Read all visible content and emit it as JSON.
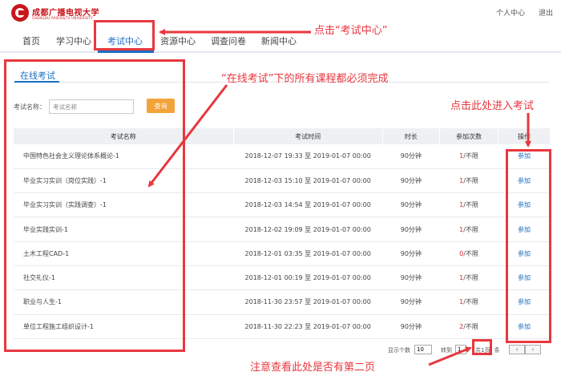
{
  "header": {
    "logo_cn": "成都广播电视大学",
    "logo_en": "CHENGDU RADIO&TV UNIVERSITY",
    "user_center": "个人中心",
    "logout": "退出"
  },
  "nav": {
    "items": [
      "首页",
      "学习中心",
      "考试中心",
      "资源中心",
      "调查问卷",
      "新闻中心"
    ],
    "active": "考试中心"
  },
  "panel": {
    "tab": "在线考试",
    "search_label": "考试名称：",
    "search_placeholder": "考试名称",
    "search_button": "查询"
  },
  "table": {
    "columns": [
      "考试名称",
      "考试时间",
      "时长",
      "参加次数",
      "操作"
    ],
    "rows": [
      {
        "name": "中国特色社会主义理论体系概论-1",
        "time": "2018-12-07 19:33 至 2019-01-07 00:00",
        "duration": "90分钟",
        "used": "1",
        "limit": "/不限",
        "action": "参加"
      },
      {
        "name": "毕业实习实训（岗位实践）-1",
        "time": "2018-12-03 15:10 至 2019-01-07 00:00",
        "duration": "90分钟",
        "used": "1",
        "limit": "/不限",
        "action": "参加"
      },
      {
        "name": "毕业实习实训（实践调查）-1",
        "time": "2018-12-03 14:54 至 2019-01-07 00:00",
        "duration": "90分钟",
        "used": "1",
        "limit": "/不限",
        "action": "参加"
      },
      {
        "name": "毕业实践实训-1",
        "time": "2018-12-02 19:09 至 2019-01-07 00:00",
        "duration": "90分钟",
        "used": "1",
        "limit": "/不限",
        "action": "参加"
      },
      {
        "name": "土木工程CAD-1",
        "time": "2018-12-01 03:35 至 2019-01-07 00:00",
        "duration": "90分钟",
        "used": "0",
        "limit": "/不限",
        "action": "参加"
      },
      {
        "name": "社交礼仪-1",
        "time": "2018-12-01 00:19 至 2019-01-07 00:00",
        "duration": "90分钟",
        "used": "1",
        "limit": "/不限",
        "action": "参加"
      },
      {
        "name": "职业与人生-1",
        "time": "2018-11-30 23:57 至 2019-01-07 00:00",
        "duration": "90分钟",
        "used": "1",
        "limit": "/不限",
        "action": "参加"
      },
      {
        "name": "单位工程施工组织设计-1",
        "time": "2018-11-30 22:23 至 2019-01-07 00:00",
        "duration": "90分钟",
        "used": "2",
        "limit": "/不限",
        "action": "参加"
      }
    ]
  },
  "pagination": {
    "per_page_label": "显示个数",
    "per_page_value": "10",
    "goto_label": "转到",
    "goto_value": "1",
    "total_pages": "共1页",
    "total_items": "8 条",
    "prev": "‹",
    "next": "›"
  },
  "annotations": {
    "click_exam_center": "点击“考试中心”",
    "must_complete": "“在线考试”下的所有课程都必须完成",
    "click_to_enter": "点击此处进入考试",
    "check_second_page": "注意查看此处是否有第二页",
    "color": "#e8373e"
  }
}
